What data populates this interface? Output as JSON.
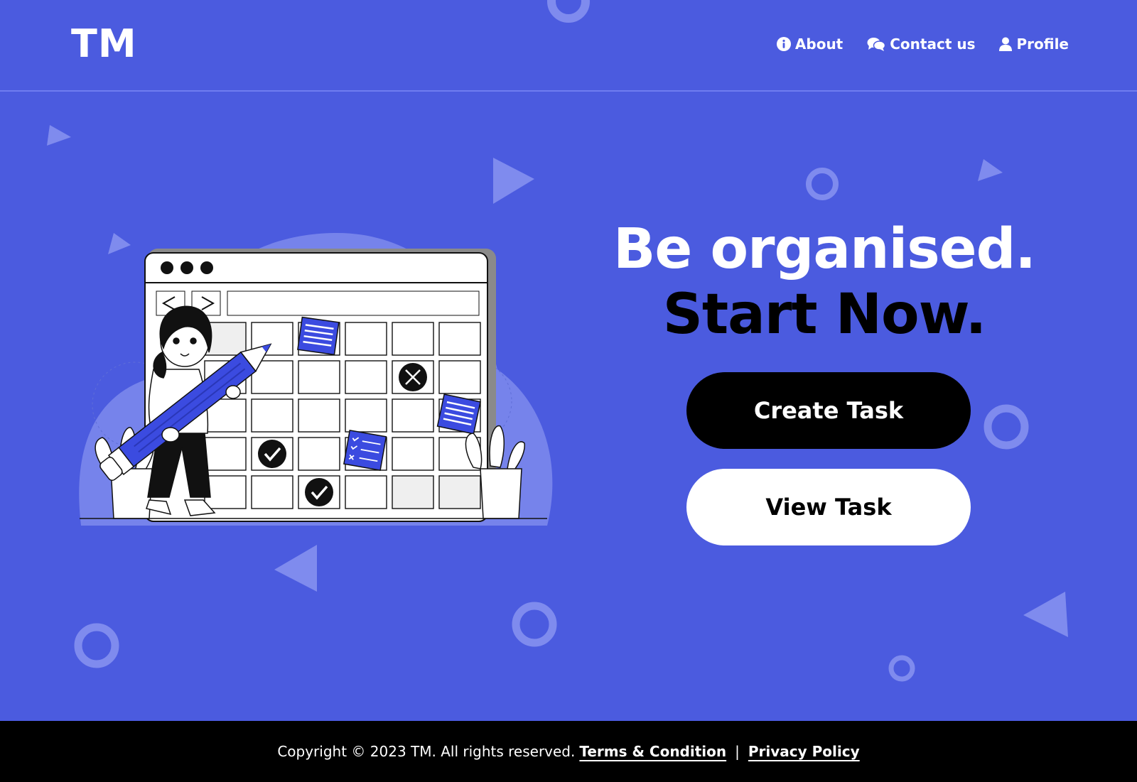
{
  "header": {
    "logo": "TM",
    "nav": [
      {
        "label": "About",
        "icon": "info-icon"
      },
      {
        "label": "Contact us",
        "icon": "chat-icon"
      },
      {
        "label": "Profile",
        "icon": "user-icon"
      }
    ]
  },
  "hero": {
    "headline_line1": "Be organised.",
    "headline_line2": "Start Now.",
    "create_button": "Create Task",
    "view_button": "View Task"
  },
  "footer": {
    "copyright": "Copyright ©  2023 TM. All rights reserved.",
    "terms": "Terms & Condition",
    "separator": "|",
    "privacy": "Privacy Policy"
  },
  "colors": {
    "background": "#4b5bdf",
    "accent_light": "#7b87ec",
    "footer": "#000000",
    "create_button_bg": "#000000",
    "view_button_bg": "#ffffff"
  }
}
